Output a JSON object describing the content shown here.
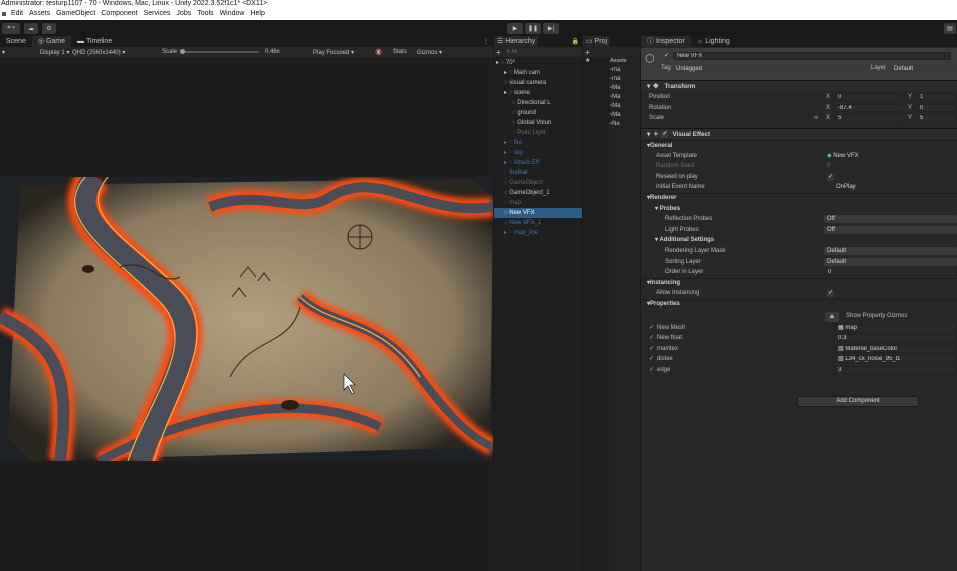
{
  "titlebar": {
    "text": "Administrator: testurp1107 - 70 - Windows, Mac, Linux - Unity 2022.3.52f1c1* <DX11>"
  },
  "menu": [
    "Edit",
    "Assets",
    "GameObject",
    "Component",
    "Services",
    "Jobs",
    "Tools",
    "Window",
    "Help"
  ],
  "toolbar": {
    "play_icon": "play-icon",
    "pause_icon": "pause-icon",
    "step_icon": "step-icon",
    "account_icon": "cloud-icon",
    "settings_icon": "gear-icon"
  },
  "scene_tabs": {
    "scene": "Scene",
    "game": "Game",
    "timeline": "Timeline"
  },
  "game_bar": {
    "display": "Display 1",
    "resolution": "QHD (2560x1440)",
    "scale_label": "Scale",
    "scale_value": "0.46x",
    "play_mode": "Play Focused",
    "stats": "Stats",
    "gizmos": "Gizmos"
  },
  "hierarchy": {
    "title": "Hierarchy",
    "search_placeholder": "All",
    "items": [
      {
        "label": "70*",
        "style": "normal"
      },
      {
        "label": "Main cam",
        "style": "normal"
      },
      {
        "label": "visual camera",
        "style": "normal"
      },
      {
        "label": "scene",
        "style": "normal"
      },
      {
        "label": "Directional L",
        "style": "normal"
      },
      {
        "label": "ground",
        "style": "normal"
      },
      {
        "label": "Global Volun",
        "style": "normal"
      },
      {
        "label": "Point Light",
        "style": "dim"
      },
      {
        "label": "fire",
        "style": "blue"
      },
      {
        "label": "sky",
        "style": "blue"
      },
      {
        "label": "Attack Eff",
        "style": "blue"
      },
      {
        "label": "fireBall",
        "style": "blue"
      },
      {
        "label": "GameObject",
        "style": "dim"
      },
      {
        "label": "GameObject_1",
        "style": "normal"
      },
      {
        "label": "map",
        "style": "dim"
      },
      {
        "label": "New VFX",
        "style": "selected"
      },
      {
        "label": "New VFX_1",
        "style": "blue"
      },
      {
        "label": "map_line",
        "style": "blue"
      }
    ]
  },
  "project": {
    "title": "Proj",
    "assets_crumb": "Assets",
    "items": [
      "ma",
      "ma",
      "Ma",
      "Ma",
      "Ma",
      "Ma",
      "Ne"
    ]
  },
  "inspector": {
    "tab_inspector": "Inspector",
    "tab_lighting": "Lighting",
    "object_name": "New VFX",
    "tag_label": "Tag",
    "tag_value": "Untagged",
    "layer_label": "Layer",
    "layer_value": "Default",
    "transform": {
      "title": "Transform",
      "position_label": "Position",
      "rotation_label": "Rotation",
      "scale_label": "Scale",
      "pos_x": "0",
      "pos_y": "1",
      "rot_x": "-87.4",
      "rot_y": "0",
      "scale_x": "5",
      "scale_y": "5"
    },
    "visual_effect": {
      "title": "Visual Effect",
      "general": "General",
      "asset_template_label": "Asset Template",
      "asset_template_value": "New VFX",
      "random_seed_label": "Random Seed",
      "random_seed_value": "0",
      "reseed_label": "Reseed on play",
      "initial_event_label": "Initial Event Name",
      "initial_event_value": "OnPlay",
      "renderer": "Renderer",
      "probes": "Probes",
      "reflection_label": "Reflection Probes",
      "reflection_value": "Off",
      "light_probes_label": "Light Probes",
      "light_probes_value": "Off",
      "additional": "Additional Settings",
      "rendering_layer_label": "Rendering Layer Mask",
      "rendering_layer_value": "Default",
      "sorting_layer_label": "Sorting Layer",
      "sorting_layer_value": "Default",
      "order_label": "Order in Layer",
      "order_value": "0",
      "instancing": "Instancing",
      "allow_instancing_label": "Allow Instancing",
      "properties": "Properties",
      "show_gizmos": "Show Property Gizmos",
      "props": [
        {
          "label": "New Mesh",
          "value": "map",
          "icon": "mesh-icon"
        },
        {
          "label": "New float",
          "value": "0.3",
          "icon": ""
        },
        {
          "label": "maintex",
          "value": "Material_baseColor",
          "icon": "texture-icon"
        },
        {
          "label": "distex",
          "value": "L34_cx_noise_95_l1",
          "icon": "texture-icon"
        },
        {
          "label": "edge",
          "value": "3",
          "icon": ""
        }
      ]
    },
    "add_component": "Add Component"
  },
  "colors": {
    "accent": "#2c5d87",
    "lava": "#ff5a1c",
    "parchment": "#c9b594"
  }
}
